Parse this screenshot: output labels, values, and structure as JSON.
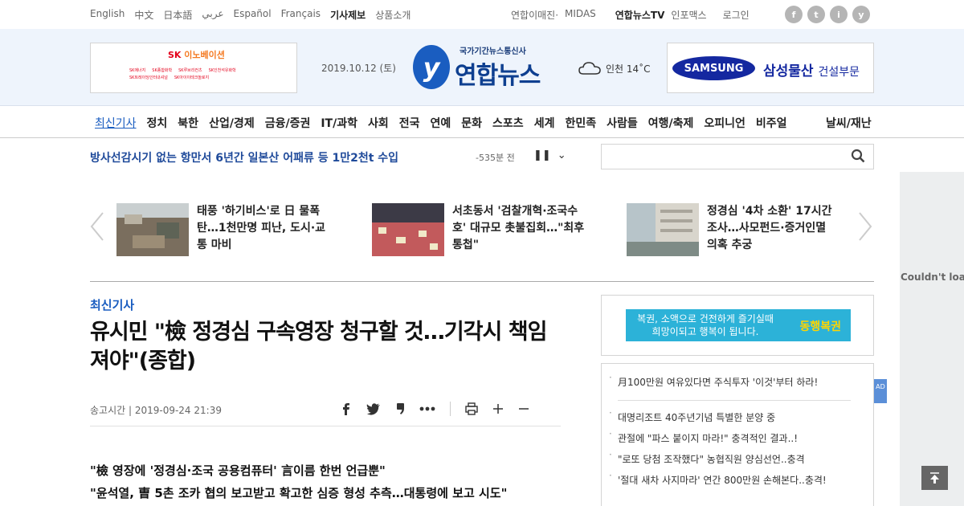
{
  "topbar": {
    "languages": [
      "English",
      "中文",
      "日本語",
      "عربي",
      "Español",
      "Français"
    ],
    "tip_label": "기사제보",
    "product_label": "상품소개",
    "util_links": [
      "연합이매진·",
      "MIDAS",
      "연합뉴스TV",
      "인포맥스",
      "로그인"
    ],
    "sns": [
      "f",
      "t",
      "i",
      "y"
    ]
  },
  "header": {
    "date": "2019.10.12 (토)",
    "logo_sub": "국가기간뉴스통신사",
    "logo_name": "연합뉴스",
    "logo_mark": "y",
    "weather": "인천 14˚C",
    "ad_left": {
      "brand": "SK",
      "brand_sub": "이노베이션",
      "items": [
        "SK에너지",
        "SK종합화학",
        "SK루브리컨츠",
        "SK인천석유화학",
        "SK트레이딩인터내셔널",
        "SK아이이테크놀로지"
      ]
    },
    "ad_right": {
      "brand": "SAMSUNG",
      "text": "삼성물산",
      "text_small": "건설부문"
    }
  },
  "nav": {
    "items": [
      "최신기사",
      "정치",
      "북한",
      "산업/경제",
      "금융/증권",
      "IT/과학",
      "사회",
      "전국",
      "연예",
      "문화",
      "스포츠",
      "세계",
      "한민족",
      "사람들",
      "여행/축제",
      "오피니언",
      "비주얼"
    ],
    "right": "날씨/재난"
  },
  "ticker": {
    "headline": "방사선감시기 없는 항만서 6년간 일본산 어패류 등 1만2천t 수입",
    "time": "-535분 전",
    "pause": "❚❚",
    "more": "⌄"
  },
  "slider": {
    "stories": [
      {
        "caption": "태풍 '하기비스'로 日 물폭탄…1천만명 피난, 도시·교통 마비"
      },
      {
        "caption": "서초동서 '검찰개혁·조국수호' 대규모 촛불집회…\"최후통첩\""
      },
      {
        "caption": "정경심 '4차 소환' 17시간 조사…사모펀드·증거인멸 의혹 추궁"
      }
    ]
  },
  "article": {
    "category": "최신기사",
    "headline": "유시민 \"檢 정경심 구속영장 청구할 것…기각시 책임져야\"(종합)",
    "meta": "송고시간 | 2019-09-24 21:39",
    "subheads": [
      "\"檢 영장에 '정경심·조국 공용컴퓨터' 言이름 한번 언급뿐\"",
      "\"윤석열, 曺 5촌 조카 협의 보고받고 확고한 심증 형성 추측…대통령에 보고 시도\""
    ]
  },
  "sidebar": {
    "lotto_line1": "복권, 소액으로 건전하게 즐기실때",
    "lotto_line2": "희망이되고 행복이 됩니다.",
    "lotto_brand": "동행복권",
    "list": [
      "月100만원 여유있다면 주식투자 '이것'부터 하라!",
      "대명리조트 40주년기념 특별한 분양 중",
      "관절에 \"파스 붙이지 마라!\" 충격적인 결과..!",
      "\"로또 당첨 조작했다\" 농협직원 양심선언..충격",
      "'절대 새차 사지마라' 연간 800만원 손해본다..충격!"
    ],
    "ad_tag": "AD",
    "side_ad_msg": "Couldn't load"
  }
}
